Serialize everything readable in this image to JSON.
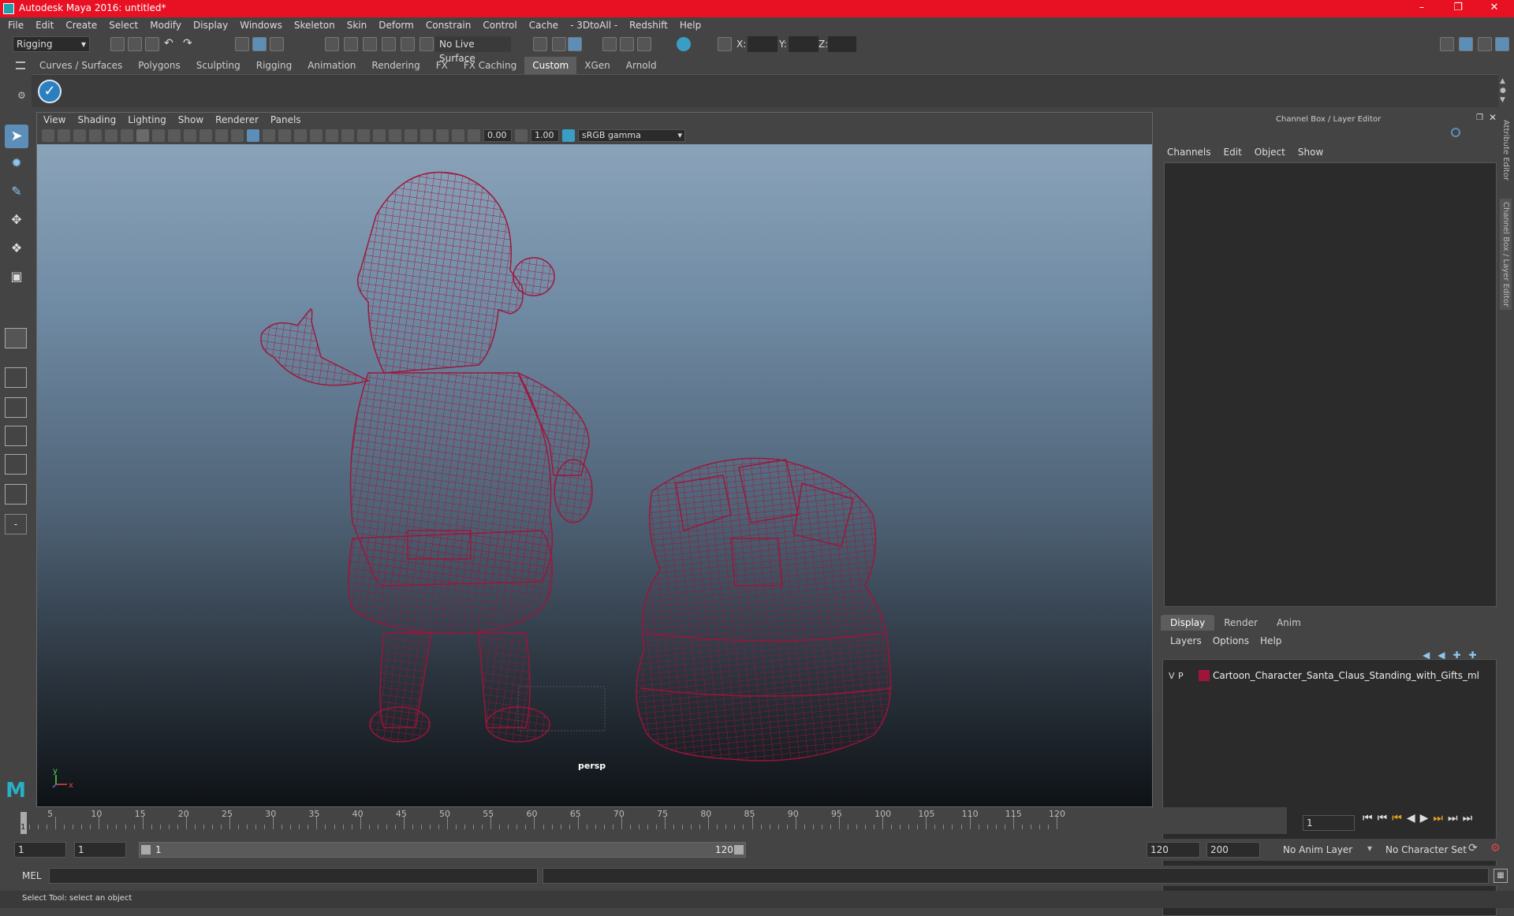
{
  "window": {
    "title": "Autodesk Maya 2016: untitled*"
  },
  "menubar": [
    "File",
    "Edit",
    "Create",
    "Select",
    "Modify",
    "Display",
    "Windows",
    "Skeleton",
    "Skin",
    "Deform",
    "Constrain",
    "Control",
    "Cache",
    "- 3DtoAll -",
    "Redshift",
    "Help"
  ],
  "statusline": {
    "mode": "Rigging",
    "live_surface": "No Live Surface",
    "x_label": "X:",
    "y_label": "Y:",
    "z_label": "Z:"
  },
  "shelf": {
    "tabs": [
      "Curves / Surfaces",
      "Polygons",
      "Sculpting",
      "Rigging",
      "Animation",
      "Rendering",
      "FX",
      "FX Caching",
      "Custom",
      "XGen",
      "Arnold"
    ],
    "active_tab": "Custom"
  },
  "viewport": {
    "menu": [
      "View",
      "Shading",
      "Lighting",
      "Show",
      "Renderer",
      "Panels"
    ],
    "exposure": "0.00",
    "gamma": "1.00",
    "color_space": "sRGB gamma",
    "camera_label": "persp",
    "axis_y": "y",
    "axis_x": "x",
    "wire_color": "#a0143a"
  },
  "channel_box": {
    "title": "Channel Box / Layer Editor",
    "menu": [
      "Channels",
      "Edit",
      "Object",
      "Show"
    ]
  },
  "layer_editor": {
    "tabs": [
      "Display",
      "Render",
      "Anim"
    ],
    "active_tab": "Display",
    "menu": [
      "Layers",
      "Options",
      "Help"
    ],
    "layers": [
      {
        "v": "V",
        "p": "P",
        "color": "#a0143a",
        "name": "Cartoon_Character_Santa_Claus_Standing_with_Gifts_ml"
      }
    ]
  },
  "side_tabs": [
    "Attribute Editor",
    "Channel Box / Layer Editor"
  ],
  "timeline": {
    "ticks": [
      5,
      10,
      15,
      20,
      25,
      30,
      35,
      40,
      45,
      50,
      55,
      60,
      65,
      70,
      75,
      80,
      85,
      90,
      95,
      100,
      105,
      110,
      115,
      120
    ],
    "current_frame_marker": "1",
    "current_frame": "1",
    "range_start": "1",
    "playback_start": "1",
    "slider_start": "1",
    "slider_end": "120",
    "playback_end": "120",
    "range_end": "200",
    "anim_layer": "No Anim Layer",
    "character_set": "No Character Set"
  },
  "command_line": {
    "label": "MEL"
  },
  "help_line": {
    "text": "Select Tool: select an object"
  }
}
